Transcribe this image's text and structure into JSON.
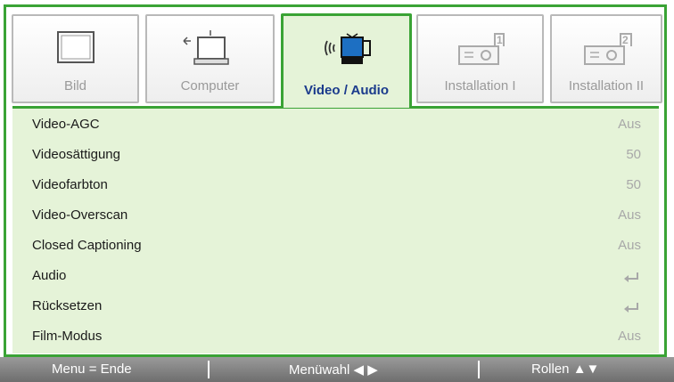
{
  "tabs": [
    {
      "label": "Bild",
      "icon": "monitor-icon",
      "active": false
    },
    {
      "label": "Computer",
      "icon": "computer-icon",
      "active": false
    },
    {
      "label": "Video / Audio",
      "icon": "video-audio-icon",
      "active": true
    },
    {
      "label": "Installation I",
      "icon": "projector-1-icon",
      "active": false
    },
    {
      "label": "Installation II",
      "icon": "projector-2-icon",
      "active": false
    }
  ],
  "menu": {
    "items": [
      {
        "label": "Video-AGC",
        "value": "Aus"
      },
      {
        "label": "Videosättigung",
        "value": "50"
      },
      {
        "label": "Videofarbton",
        "value": "50"
      },
      {
        "label": "Video-Overscan",
        "value": "Aus"
      },
      {
        "label": "Closed Captioning",
        "value": "Aus"
      },
      {
        "label": "Audio",
        "value": "",
        "icon": "enter-icon"
      },
      {
        "label": "Rücksetzen",
        "value": "",
        "icon": "enter-icon"
      },
      {
        "label": "Film-Modus",
        "value": "Aus"
      }
    ]
  },
  "footer": {
    "exit": "Menu = Ende",
    "select": "Menüwahl ◀ ▶",
    "scroll": "Rollen ▲▼"
  },
  "colors": {
    "accent": "#3aa335",
    "panel": "#e5f3d8",
    "active_text": "#1a3a8c"
  }
}
